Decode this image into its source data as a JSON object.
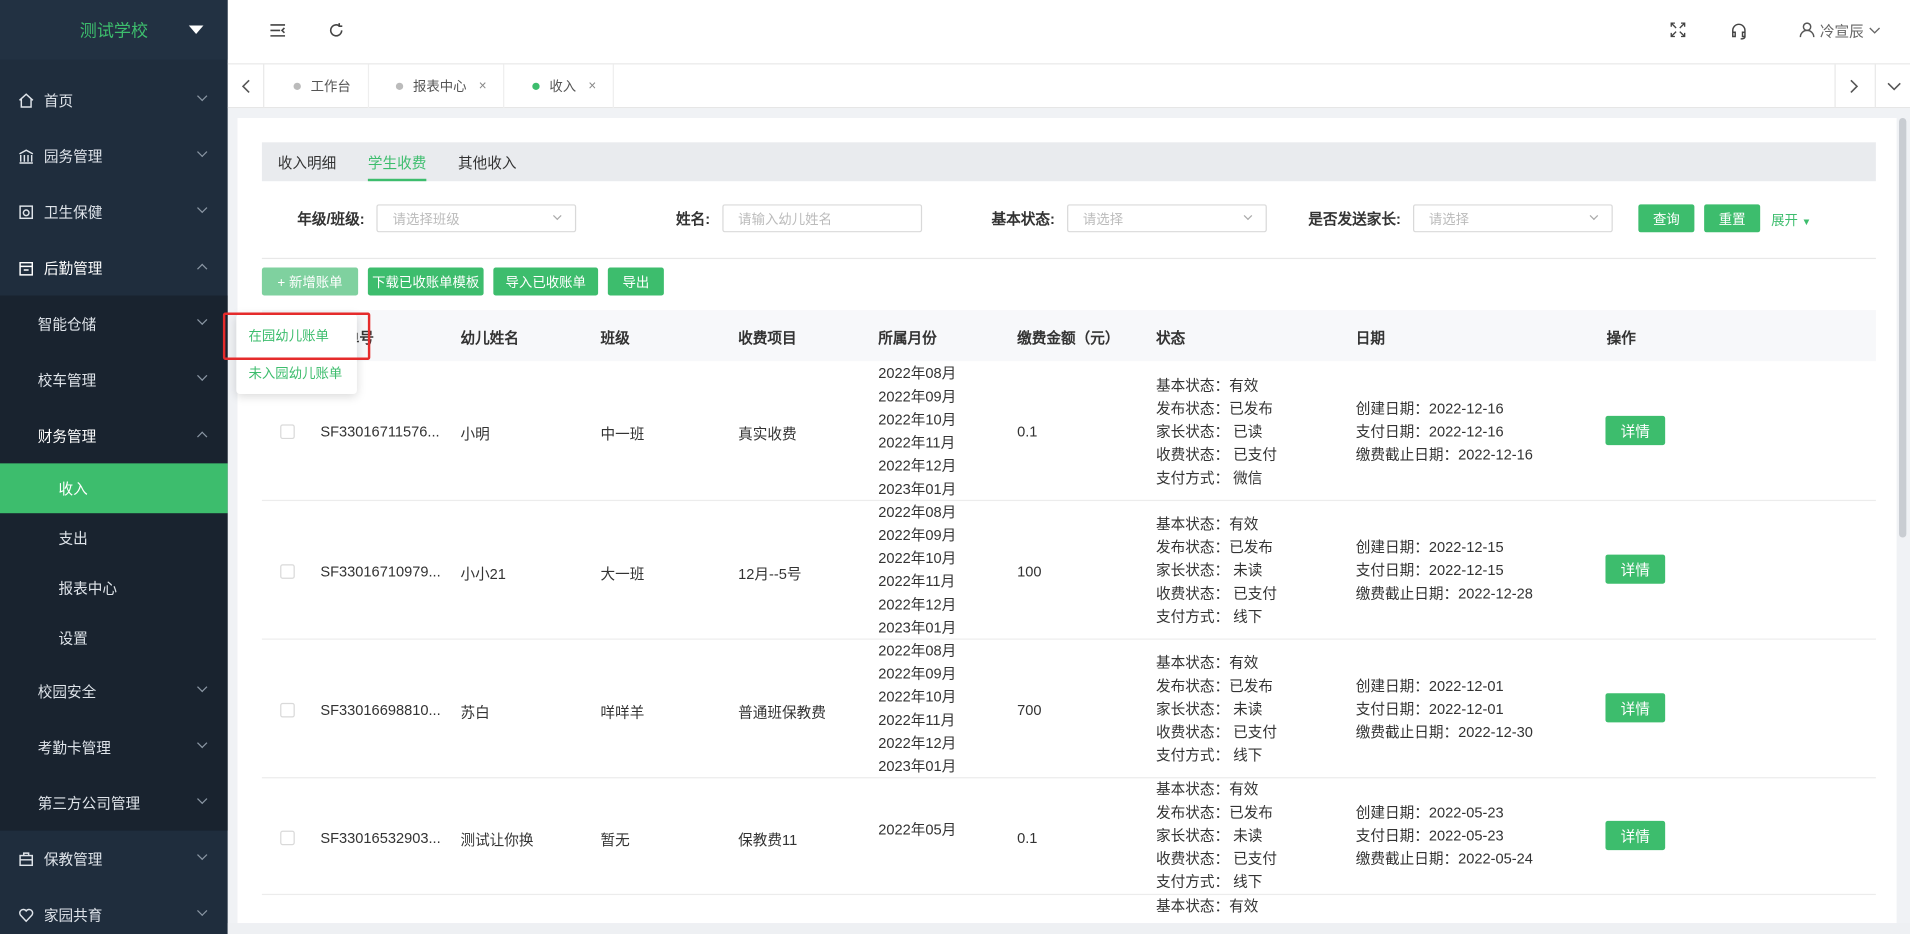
{
  "sidebar": {
    "school": "测试学校",
    "items": [
      {
        "label": "首页",
        "icon": "home-icon"
      },
      {
        "label": "园务管理",
        "icon": "bank-icon"
      },
      {
        "label": "卫生保健",
        "icon": "health-icon"
      },
      {
        "label": "后勤管理",
        "icon": "building-icon"
      }
    ],
    "sub": [
      {
        "label": "智能仓储"
      },
      {
        "label": "校车管理"
      },
      {
        "label": "财务管理"
      }
    ],
    "leaves": [
      "收入",
      "支出",
      "报表中心",
      "设置"
    ],
    "sub2": [
      {
        "label": "校园安全"
      },
      {
        "label": "考勤卡管理"
      },
      {
        "label": "第三方公司管理"
      }
    ],
    "bottom": [
      {
        "label": "保教管理",
        "icon": "briefcase-icon"
      },
      {
        "label": "家园共育",
        "icon": "heart-icon"
      }
    ]
  },
  "header": {
    "user": "冷宣辰"
  },
  "tabs": [
    {
      "label": "工作台"
    },
    {
      "label": "报表中心",
      "close": "×"
    },
    {
      "label": "收入",
      "close": "×"
    }
  ],
  "subtabs": [
    "收入明细",
    "学生收费",
    "其他收入"
  ],
  "filters": {
    "grade_label": "年级/班级:",
    "grade_placeholder": "请选择班级",
    "name_label": "姓名:",
    "name_placeholder": "请输入幼儿姓名",
    "status_label": "基本状态:",
    "status_placeholder": "请选择",
    "send_label": "是否发送家长:",
    "send_placeholder": "请选择",
    "query": "查询",
    "reset": "重置",
    "expand": "展开"
  },
  "actions": {
    "add": "+ 新增账单",
    "download": "下载已收账单模板",
    "import": "导入已收账单",
    "export": "导出"
  },
  "popup": {
    "in_school": "在园幼儿账单",
    "not_in_school": "未入园幼儿账单"
  },
  "table": {
    "headers": {
      "no": "单号",
      "name": "幼儿姓名",
      "class": "班级",
      "item": "收费项目",
      "month": "所属月份",
      "amount": "缴费金额（元）",
      "status": "状态",
      "date": "日期",
      "op": "操作"
    },
    "rows": [
      {
        "no": "SF33016711576...",
        "name": "小明",
        "class": "中一班",
        "item": "真实收费",
        "months": [
          "2022年08月",
          "2022年09月",
          "2022年10月",
          "2022年11月",
          "2022年12月",
          "2023年01月"
        ],
        "amount": "0.1",
        "status": [
          "基本状态：有效",
          "发布状态：已发布",
          "家长状态： 已读",
          "收费状态： 已支付",
          "支付方式： 微信"
        ],
        "dates": [
          "创建日期：2022-12-16",
          "支付日期：2022-12-16",
          "缴费截止日期：2022-12-16"
        ],
        "op": "详情"
      },
      {
        "no": "SF33016710979...",
        "name": "小小21",
        "class": "大一班",
        "item": "12月--5号",
        "months": [
          "2022年08月",
          "2022年09月",
          "2022年10月",
          "2022年11月",
          "2022年12月",
          "2023年01月"
        ],
        "amount": "100",
        "status": [
          "基本状态：有效",
          "发布状态：已发布",
          "家长状态： 未读",
          "收费状态： 已支付",
          "支付方式： 线下"
        ],
        "dates": [
          "创建日期：2022-12-15",
          "支付日期：2022-12-15",
          "缴费截止日期：2022-12-28"
        ],
        "op": "详情"
      },
      {
        "no": "SF33016698810...",
        "name": "苏白",
        "class": "咩咩羊",
        "item": "普通班保教费",
        "months": [
          "2022年08月",
          "2022年09月",
          "2022年10月",
          "2022年11月",
          "2022年12月",
          "2023年01月"
        ],
        "amount": "700",
        "status": [
          "基本状态：有效",
          "发布状态：已发布",
          "家长状态： 未读",
          "收费状态： 已支付",
          "支付方式： 线下"
        ],
        "dates": [
          "创建日期：2022-12-01",
          "支付日期：2022-12-01",
          "缴费截止日期：2022-12-30"
        ],
        "op": "详情"
      },
      {
        "no": "SF33016532903...",
        "name": "测试让你换",
        "class": "暂无",
        "item": "保教费11",
        "months": [
          "2022年05月"
        ],
        "amount": "0.1",
        "status": [
          "基本状态：有效",
          "发布状态：已发布",
          "家长状态： 未读",
          "收费状态： 已支付",
          "支付方式： 线下"
        ],
        "dates": [
          "创建日期：2022-05-23",
          "支付日期：2022-05-23",
          "缴费截止日期：2022-05-24"
        ],
        "op": "详情"
      }
    ],
    "partial_status": "基本状态：有效"
  }
}
